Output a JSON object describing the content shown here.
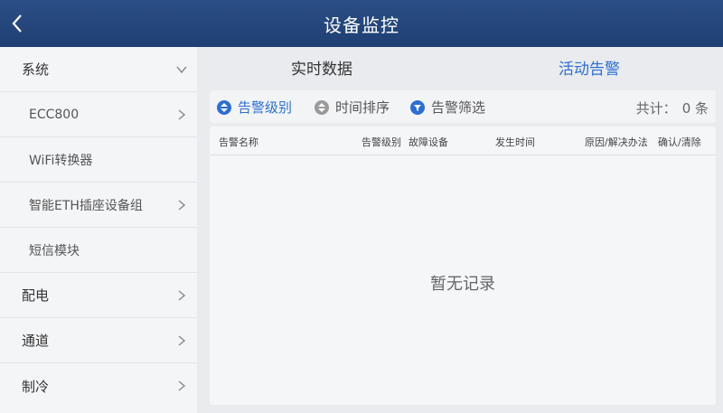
{
  "header": {
    "title": "设备监控",
    "back_icon": "chevron-left-icon"
  },
  "sidebar": {
    "items": [
      {
        "label": "系统",
        "chevron": "chevron-down-icon"
      },
      {
        "label": "ECC800",
        "chevron": "chevron-right-icon"
      },
      {
        "label": "WiFi转换器"
      },
      {
        "label": "智能ETH插座设备组",
        "chevron": "chevron-right-icon"
      },
      {
        "label": "短信模块"
      },
      {
        "label": "配电",
        "chevron": "chevron-right-icon"
      },
      {
        "label": "通道",
        "chevron": "chevron-right-icon"
      },
      {
        "label": "制冷",
        "chevron": "chevron-right-icon"
      }
    ]
  },
  "tabs": {
    "realtime": "实时数据",
    "active_alarms": "活动告警"
  },
  "filters": {
    "level": "告警级别",
    "time_sort": "时间排序",
    "filter": "告警筛选",
    "total_label": "共计：",
    "total_count": "0 条"
  },
  "table": {
    "columns": [
      "告警名称",
      "告警级别",
      "故障设备",
      "发生时间",
      "原因/解决办法",
      "确认/清除"
    ],
    "empty_text": "暂无记录"
  },
  "colors": {
    "header": "#1e3f73",
    "accent": "#2a6fd6",
    "muted": "#9a9a9a"
  }
}
